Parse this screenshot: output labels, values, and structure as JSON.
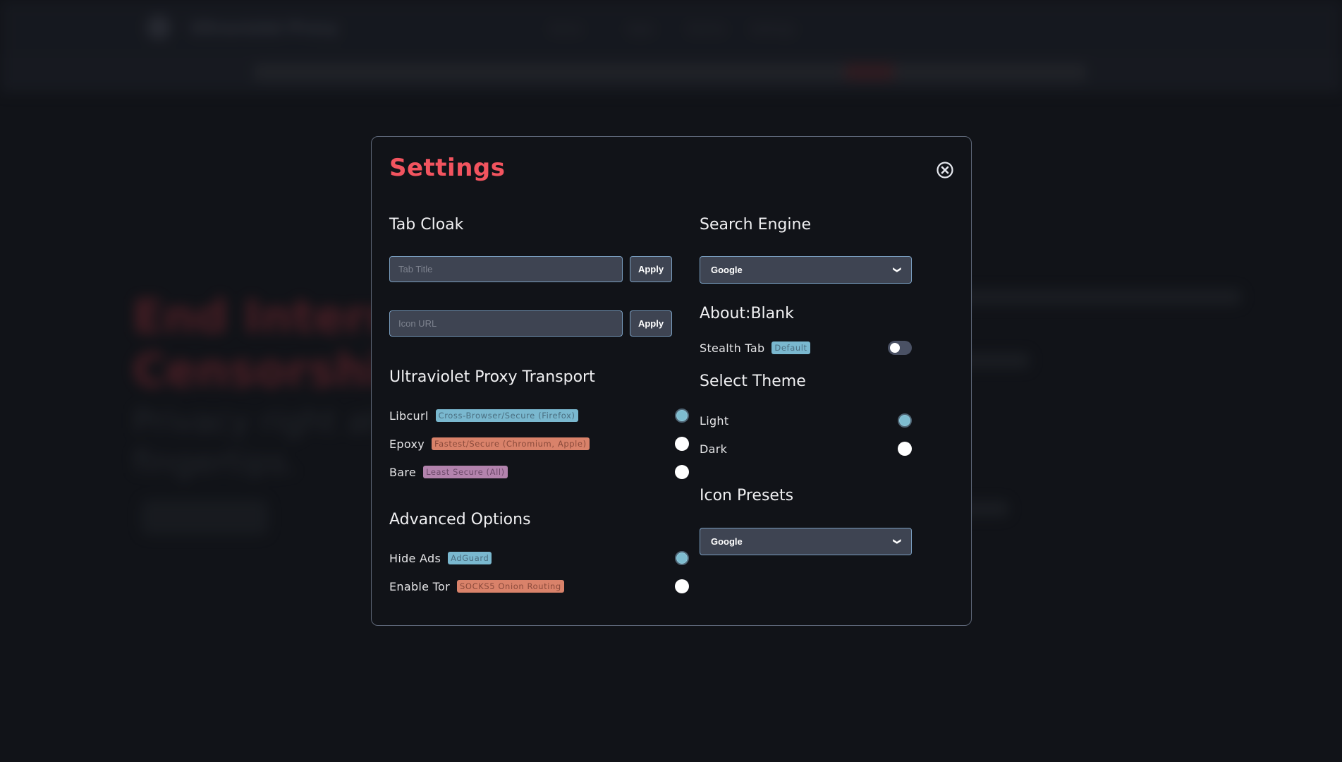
{
  "background": {
    "brand": "Ultraviolet Proxy",
    "nav_links": [
      "Home",
      "Apps",
      "Games",
      "Settings"
    ],
    "hero_title_line1": "End Interne",
    "hero_title_line2": "Censorship",
    "hero_subtitle_line1": "Privacy right at y",
    "hero_subtitle_line2": "fingertips."
  },
  "modal": {
    "title": "Settings",
    "close_icon": "close-circle-icon",
    "tab_cloak": {
      "title": "Tab Cloak",
      "tab_title_input": {
        "placeholder": "Tab Title",
        "value": ""
      },
      "tab_title_apply": "Apply",
      "icon_url_input": {
        "placeholder": "Icon URL",
        "value": ""
      },
      "icon_url_apply": "Apply"
    },
    "proxy_transport": {
      "title": "Ultraviolet Proxy Transport",
      "options": [
        {
          "label": "Libcurl",
          "badge": "Cross-Browser/Secure (Firefox)",
          "badge_color": "#7ab8cf",
          "selected": true
        },
        {
          "label": "Epoxy",
          "badge": "Fastest/Secure (Chromium, Apple)",
          "badge_color": "#d9826a",
          "selected": false
        },
        {
          "label": "Bare",
          "badge": "Least Secure (All)",
          "badge_color": "#b383ad",
          "selected": false
        }
      ]
    },
    "advanced": {
      "title": "Advanced Options",
      "options": [
        {
          "label": "Hide Ads",
          "badge": "AdGuard",
          "badge_color": "#7ab8cf",
          "selected": true
        },
        {
          "label": "Enable Tor",
          "badge": "SOCKS5 Onion Routing",
          "badge_color": "#d9826a",
          "selected": false
        }
      ]
    },
    "search_engine": {
      "title": "Search Engine",
      "selected": "Google"
    },
    "about_blank": {
      "title": "About:Blank",
      "stealth_label": "Stealth Tab",
      "stealth_badge": "Default",
      "stealth_enabled": false
    },
    "theme": {
      "title": "Select Theme",
      "options": [
        {
          "label": "Light",
          "selected": true
        },
        {
          "label": "Dark",
          "selected": false
        }
      ]
    },
    "icon_presets": {
      "title": "Icon Presets",
      "selected": "Google"
    }
  },
  "colors": {
    "accent": "#f2545f",
    "selected_radio": "#7ebccf",
    "input_bg": "#3e4452",
    "input_border": "#7a9ec0",
    "modal_bg": "#111318"
  }
}
